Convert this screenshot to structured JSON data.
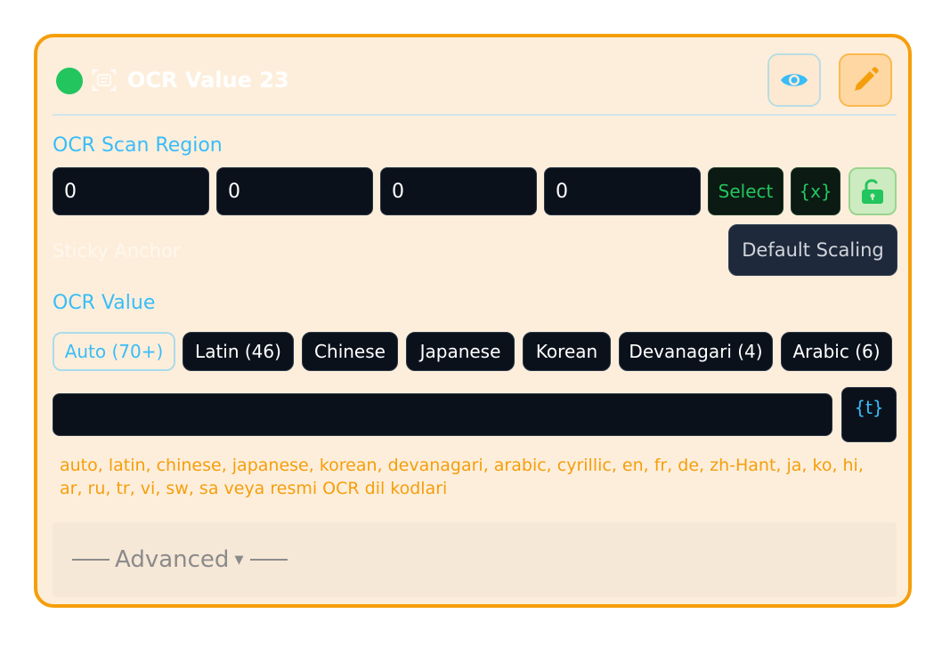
{
  "header": {
    "title": "OCR Value 23",
    "status_color": "#22c55e",
    "icons": [
      "ocr-scan-icon",
      "eye-icon",
      "pencil-icon"
    ]
  },
  "scan_region": {
    "label": "OCR Scan Region",
    "values": [
      "0",
      "0",
      "0",
      "0"
    ],
    "select_label": "Select",
    "variable_label": "{x}",
    "lock_icon": "unlock-icon"
  },
  "sticky_anchor_label": "Sticky Anchor",
  "default_scaling_label": "Default Scaling",
  "ocr_value": {
    "label": "OCR Value",
    "languages": [
      {
        "label": "Auto (70+)",
        "active": true
      },
      {
        "label": "Latin (46)",
        "active": false
      },
      {
        "label": "Chinese",
        "active": false
      },
      {
        "label": "Japanese",
        "active": false
      },
      {
        "label": "Korean",
        "active": false
      },
      {
        "label": "Devanagari (4)",
        "active": false
      },
      {
        "label": "Arabic (6)",
        "active": false
      }
    ],
    "input_value": "",
    "template_button_label": "{t}",
    "hint": "auto, latin, chinese, japanese, korean, devanagari, arabic, cyrillic, en, fr, de, zh-Hant, ja, ko, hi, ar, ru, tr, vi, sw, sa veya resmi OCR dil kodlari"
  },
  "advanced": {
    "label": "Advanced"
  },
  "colors": {
    "accent_border": "#f59e0b",
    "panel_background": "#fdeedb",
    "label_blue": "#38bdf8",
    "dark_field": "#0b111b"
  }
}
